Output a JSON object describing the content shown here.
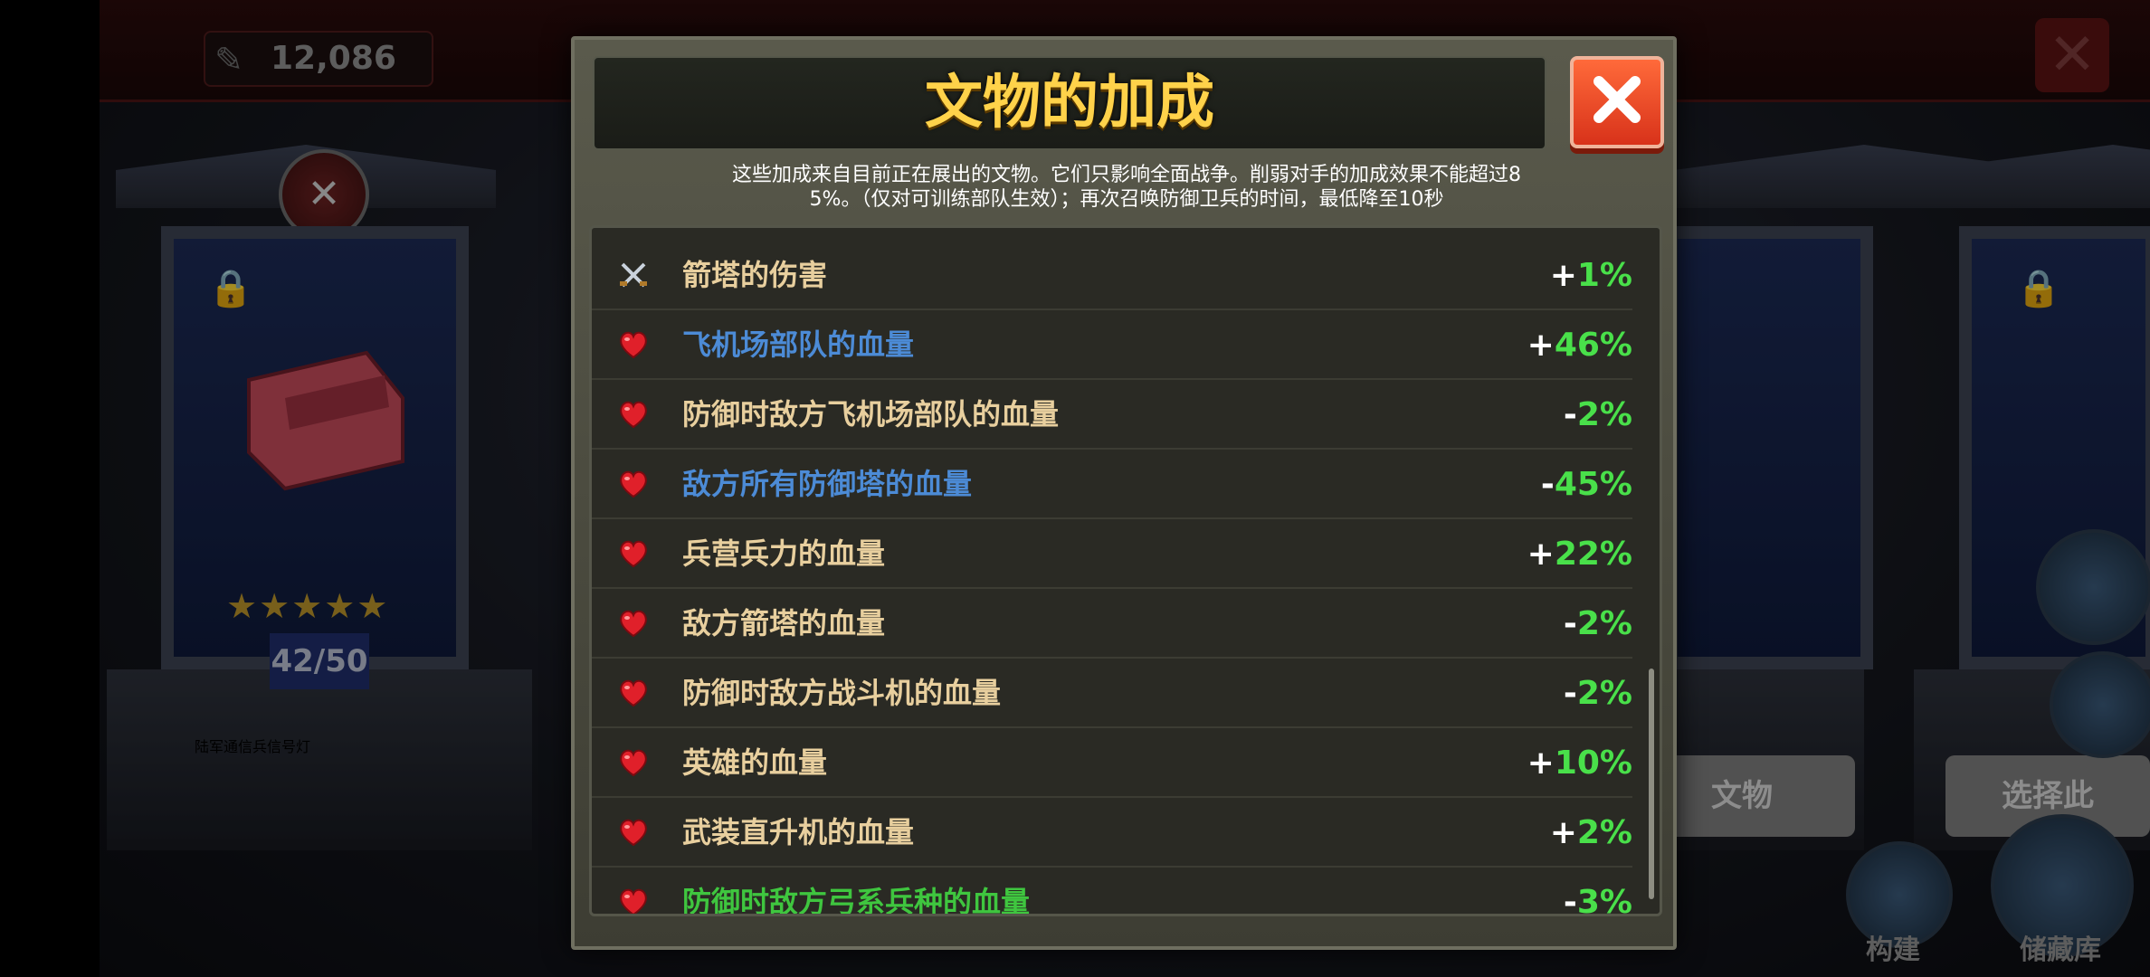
{
  "background": {
    "currency_value": "12,086",
    "left_case": {
      "rating_stars": 5,
      "count": "42/50",
      "artifact_name": "陆军通信兵信号灯"
    },
    "right_buttons": [
      "此文物\n用",
      "选择此"
    ],
    "bottom_labels": [
      "构建",
      "储藏库"
    ]
  },
  "modal": {
    "title": "文物的加成",
    "description_line1": "这些加成来自目前正在展出的文物。它们只影响全面战争。削弱对手的加成效果不能超过8",
    "description_line2": "5%。（仅对可训练部队生效）；再次召唤防御卫兵的时间，最低降至10秒",
    "rows": [
      {
        "icon": "crossed-swords-icon",
        "name": "箭塔的伤害",
        "sign": "+",
        "value": "1%",
        "name_color": "tan"
      },
      {
        "icon": "heart-icon",
        "name": "飞机场部队的血量",
        "sign": "+",
        "value": "46%",
        "name_color": "blue"
      },
      {
        "icon": "heart-icon",
        "name": "防御时敌方飞机场部队的血量",
        "sign": "-",
        "value": "2%",
        "name_color": "tan"
      },
      {
        "icon": "heart-icon",
        "name": "敌方所有防御塔的血量",
        "sign": "-",
        "value": "45%",
        "name_color": "blue"
      },
      {
        "icon": "heart-icon",
        "name": "兵营兵力的血量",
        "sign": "+",
        "value": "22%",
        "name_color": "tan"
      },
      {
        "icon": "heart-icon",
        "name": "敌方箭塔的血量",
        "sign": "-",
        "value": "2%",
        "name_color": "tan"
      },
      {
        "icon": "heart-icon",
        "name": "防御时敌方战斗机的血量",
        "sign": "-",
        "value": "2%",
        "name_color": "tan"
      },
      {
        "icon": "heart-icon",
        "name": "英雄的血量",
        "sign": "+",
        "value": "10%",
        "name_color": "tan"
      },
      {
        "icon": "heart-icon",
        "name": "武装直升机的血量",
        "sign": "+",
        "value": "2%",
        "name_color": "tan"
      },
      {
        "icon": "heart-icon",
        "name": "防御时敌方弓系兵种的血量",
        "sign": "-",
        "value": "3%",
        "name_color": "green"
      }
    ]
  },
  "colors": {
    "title": "#ffd24a",
    "value_green": "#49e04a",
    "name_tan": "#e8cf9e",
    "name_blue": "#4c8bd6",
    "name_green": "#3fc63f",
    "close_red": "#d8321a"
  }
}
